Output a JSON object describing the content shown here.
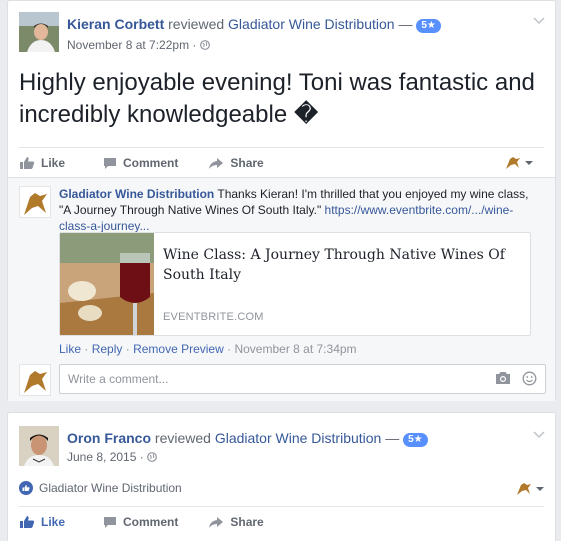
{
  "posts": [
    {
      "author": "Kieran Corbett",
      "verb": "reviewed",
      "page": "Gladiator Wine Distribution",
      "dash": "—",
      "rating": "5★",
      "time": "November 8 at 7:22pm",
      "privacy_sep": "·",
      "body": "Highly enjoyable evening! Toni was fantastic and incredibly knowledgeable �",
      "actions": {
        "like": "Like",
        "comment": "Comment",
        "share": "Share"
      },
      "comment": {
        "author": "Gladiator Wine Distribution",
        "text": "Thanks Kieran! I'm thrilled that you enjoyed my wine class, \"A Journey Through Native Wines Of South Italy.\"",
        "url": "https://www.eventbrite.com/.../wine-class-a-journey...",
        "preview": {
          "title": "Wine Class: A Journey Through Native Wines Of South Italy",
          "domain": "EVENTBRITE.COM"
        },
        "meta": {
          "like": "Like",
          "sep1": "·",
          "reply": "Reply",
          "sep2": "·",
          "remove": "Remove Preview",
          "sep3": "·",
          "time": "November 8 at 7:34pm"
        }
      },
      "write_placeholder": "Write a comment..."
    },
    {
      "author": "Oron Franco",
      "verb": "reviewed",
      "page": "Gladiator Wine Distribution",
      "dash": "—",
      "rating": "5★",
      "time": "June 8, 2015",
      "privacy_sep": "·",
      "recommendation": "Gladiator Wine Distribution",
      "actions": {
        "like": "Like",
        "comment": "Comment",
        "share": "Share"
      }
    }
  ],
  "icons": {
    "chevron": "chevron-down-icon",
    "globe": "globe-icon",
    "like": "thumbs-up-icon",
    "comment": "comment-bubble-icon",
    "share": "share-arrow-icon",
    "camera": "camera-icon",
    "emoji": "smiley-icon"
  },
  "colors": {
    "link": "#365899",
    "rating": "#5890ff",
    "liked": "#4267b2"
  }
}
